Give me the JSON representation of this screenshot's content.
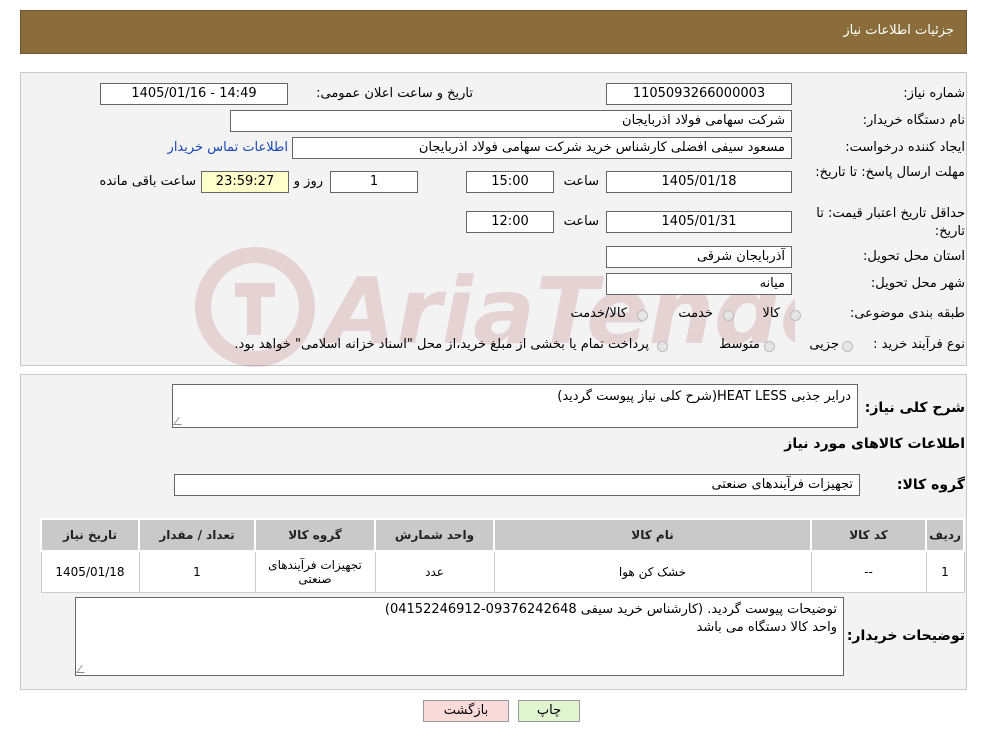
{
  "header": {
    "title": "جزئیات اطلاعات نیاز"
  },
  "form": {
    "need_number_label": "شماره نیاز:",
    "need_number": "1105093266000003",
    "announce_label": "تاریخ و ساعت اعلان عمومی:",
    "announce_value": "1405/01/16 - 14:49",
    "buyer_org_label": "نام دستگاه خریدار:",
    "buyer_org": "شرکت سهامی فولاد اذربایجان",
    "creator_label": "ایجاد کننده درخواست:",
    "creator": "مسعود سیفی افضلی کارشناس خرید شرکت سهامی فولاد اذربایجان",
    "contact_link": "اطلاعات تماس خریدار",
    "send_deadline_label": "مهلت ارسال پاسخ: تا تاریخ:",
    "send_date": "1405/01/18",
    "time_label": "ساعت",
    "send_time": "15:00",
    "days_value": "1",
    "days_label": "روز و",
    "remaining_time": "23:59:27",
    "remaining_label": "ساعت باقی مانده",
    "min_validity_label": "حداقل تاریخ اعتبار قیمت: تا تاریخ:",
    "validity_date": "1405/01/31",
    "validity_time": "12:00",
    "province_label": "استان محل تحویل:",
    "province": "آذربایجان شرقی",
    "city_label": "شهر محل تحویل:",
    "city": "میانه",
    "category_label": "طبقه بندی موضوعی:",
    "category_options": [
      "کالا",
      "خدمت",
      "کالا/خدمت"
    ],
    "process_label": "نوع فرآیند خرید :",
    "process_options": [
      "جزیی",
      "متوسط"
    ],
    "process_note": "پرداخت تمام یا بخشی از مبلغ خرید،از محل \"اسناد خزانه اسلامی\" خواهد بود."
  },
  "details": {
    "desc_label": "شرح کلی نیاز:",
    "desc_value": "درایر جذبی HEAT LESS(شرح کلی نیاز پیوست گردید)",
    "goods_info_title": "اطلاعات کالاهای مورد نیاز",
    "goods_group_label": "گروه کالا:",
    "goods_group": "تجهیزات فرآیندهای صنعتی",
    "table": {
      "headers": [
        "ردیف",
        "کد کالا",
        "نام کالا",
        "واحد شمارش",
        "گروه کالا",
        "تعداد / مقدار",
        "تاریخ نیاز"
      ],
      "rows": [
        [
          "1",
          "--",
          "خشک کن هوا",
          "عدد",
          "تجهیزات فرآیندهای صنعتی",
          "1",
          "1405/01/18"
        ]
      ]
    },
    "buyer_notes_label": "توضیحات خریدار:",
    "buyer_notes_line1": "توضیحات پیوست گردید. (کارشناس خرید سیفی 09376242648-04152246912)",
    "buyer_notes_line2": "واحد کالا دستگاه می باشد"
  },
  "buttons": {
    "print": "چاپ",
    "back": "بازگشت"
  },
  "colors": {
    "header": "#8a6d3b",
    "timer": "#ffffcc",
    "print_btn": "#dff5d0",
    "back_btn": "#fbdada",
    "link": "#1a47b8"
  }
}
